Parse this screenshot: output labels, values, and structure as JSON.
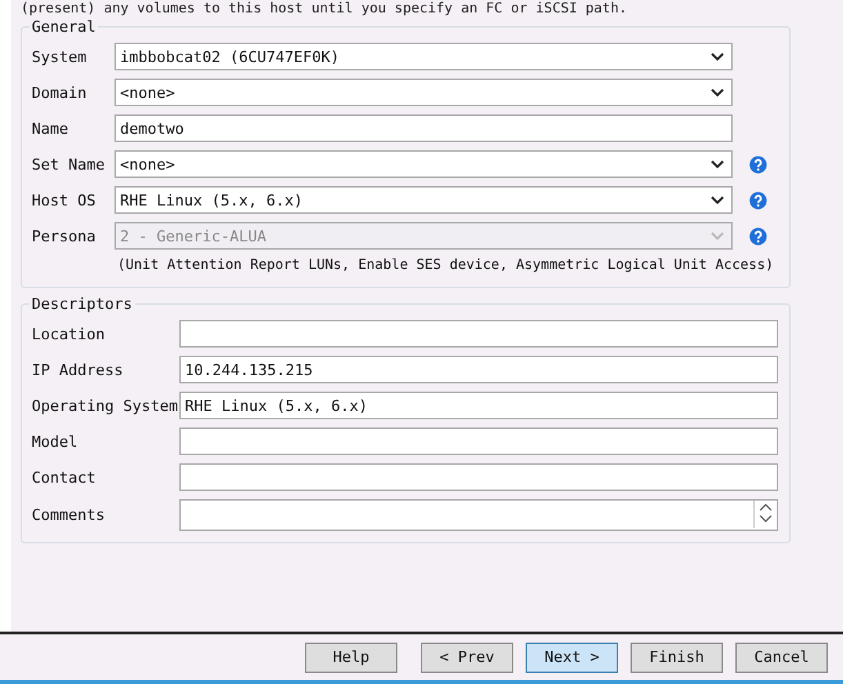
{
  "intro": "(present) any volumes to this host until you specify an FC or iSCSI path.",
  "general": {
    "title": "General",
    "rows": [
      {
        "label": "System",
        "kind": "select",
        "value": "imbbobcat02 (6CU747EF0K)",
        "disabled": false,
        "help": false
      },
      {
        "label": "Domain",
        "kind": "select",
        "value": "<none>",
        "disabled": false,
        "help": false
      },
      {
        "label": "Name",
        "kind": "text",
        "value": "demotwo",
        "disabled": false,
        "help": false
      },
      {
        "label": "Set Name",
        "kind": "select",
        "value": "<none>",
        "disabled": false,
        "help": true
      },
      {
        "label": "Host OS",
        "kind": "select",
        "value": "RHE Linux (5.x, 6.x)",
        "disabled": false,
        "help": true
      },
      {
        "label": "Persona",
        "kind": "select",
        "value": "2 - Generic-ALUA",
        "disabled": true,
        "help": true
      }
    ],
    "note": "(Unit Attention Report LUNs, Enable SES device, Asymmetric Logical Unit Access)"
  },
  "descriptors": {
    "title": "Descriptors",
    "rows": [
      {
        "label": "Location",
        "kind": "text",
        "value": ""
      },
      {
        "label": "IP Address",
        "kind": "text",
        "value": "10.244.135.215"
      },
      {
        "label": "Operating System",
        "kind": "text",
        "value": "RHE Linux (5.x, 6.x)"
      },
      {
        "label": "Model",
        "kind": "text",
        "value": ""
      },
      {
        "label": "Contact",
        "kind": "text",
        "value": ""
      },
      {
        "label": "Comments",
        "kind": "textarea",
        "value": ""
      }
    ]
  },
  "buttons": [
    {
      "label": "Help",
      "selected": false
    },
    {
      "label": "< Prev",
      "selected": false
    },
    {
      "label": "Next >",
      "selected": true
    },
    {
      "label": "Finish",
      "selected": false
    },
    {
      "label": "Cancel",
      "selected": false
    }
  ]
}
